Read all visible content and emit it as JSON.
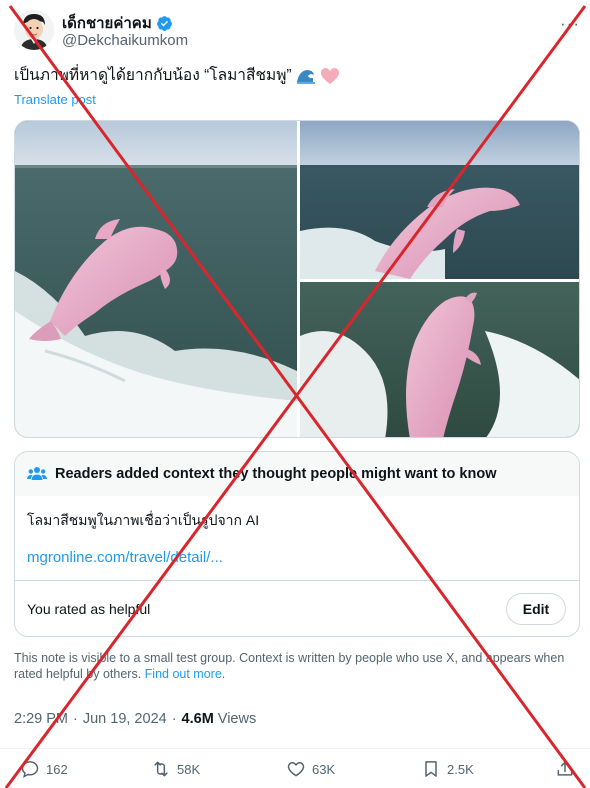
{
  "author": {
    "display_name": "เด็กชายค่าคม",
    "handle": "@Dekchaikumkom",
    "verified": true
  },
  "tweet": {
    "text": "เป็นภาพที่หาดูได้ยากกับน้อง “โลมาสีชมพู”",
    "emojis": [
      "wave-emoji",
      "pink-heart-emoji"
    ],
    "translate_label": "Translate post"
  },
  "media": {
    "images": [
      "pink-dolphin-photo-1",
      "pink-dolphin-photo-2",
      "pink-dolphin-photo-3"
    ]
  },
  "community_note": {
    "header": "Readers added context they thought people might want to know",
    "body": "โลมาสีชมพูในภาพเชื่อว่าเป็นรูปจาก AI",
    "link": "mgronline.com/travel/detail/...",
    "rating_text": "You rated as helpful",
    "edit_label": "Edit"
  },
  "disclaimer": {
    "text": "This note is visible to a small test group. Context is written by people who use X, and appears when rated helpful by others.",
    "link_label": "Find out more",
    "suffix": "."
  },
  "meta": {
    "time": "2:29 PM",
    "separator": "·",
    "date": "Jun 19, 2024",
    "views": "4.6M",
    "views_label": "Views"
  },
  "actions": {
    "replies": "162",
    "reposts": "58K",
    "likes": "63K",
    "bookmarks": "2.5K"
  },
  "colors": {
    "accent": "#1d9bf0",
    "overlay_cross": "#d9262c",
    "muted_text": "#536471"
  }
}
